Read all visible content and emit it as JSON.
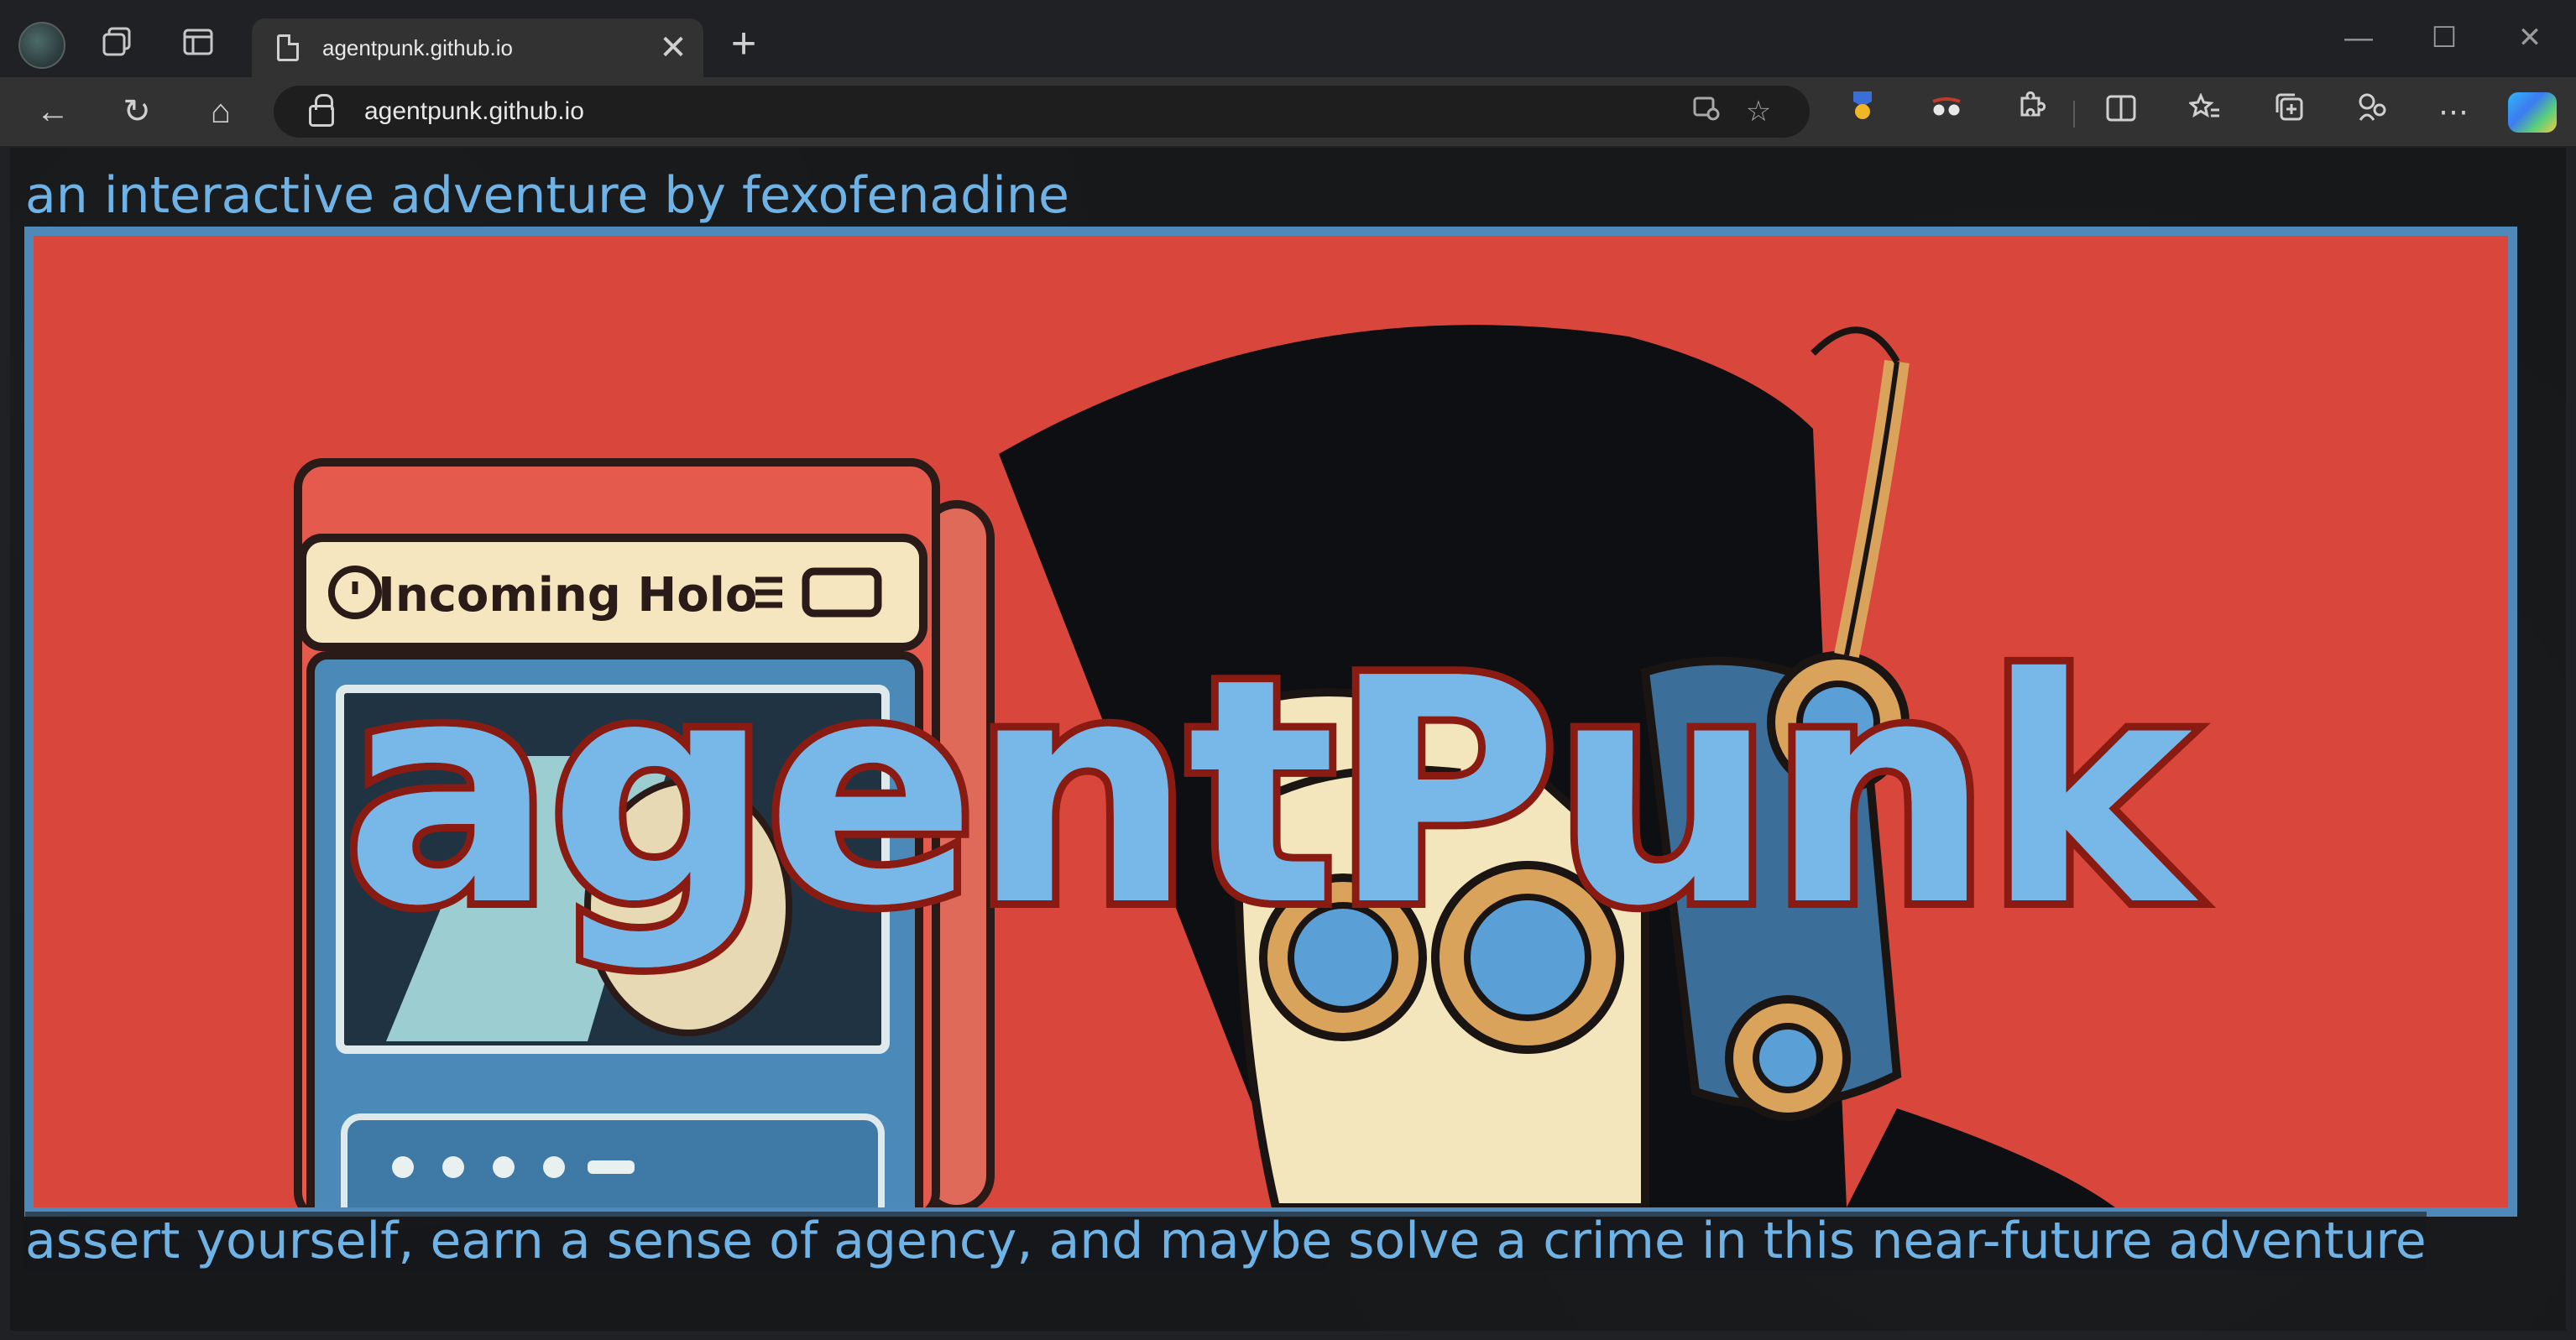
{
  "browser": {
    "tab_title": "agentpunk.github.io",
    "address": "agentpunk.github.io",
    "close_glyph": "✕",
    "new_tab_glyph": "+",
    "minimize_glyph": "—",
    "maximize_glyph": "☐",
    "window_close_glyph": "✕",
    "back_glyph": "←",
    "refresh_glyph": "↻",
    "home_glyph": "⌂",
    "icons": [
      "profile-icon",
      "workspaces-icon",
      "tab-actions-icon",
      "document-icon",
      "lock-icon",
      "app-available-icon",
      "favorite-star-icon",
      "extension-badge-icon",
      "extension-glasses-icon",
      "extensions-icon",
      "split-screen-icon",
      "favorites-icon",
      "collections-icon",
      "performance-icon",
      "more-icon",
      "copilot-icon"
    ]
  },
  "page": {
    "tagline": "an interactive adventure by fexofenadine",
    "logo": "agentPunk",
    "device_screen_text": "Incoming Holo",
    "description": "assert yourself, earn a sense of agency, and maybe solve a crime in this near-future adventure"
  },
  "colors": {
    "accent_text": "#6fb3e6",
    "banner_bg": "#d9473c",
    "banner_border": "#4e89b9",
    "logo_fill": "#78b8e8",
    "logo_stroke": "#8a1b12"
  }
}
